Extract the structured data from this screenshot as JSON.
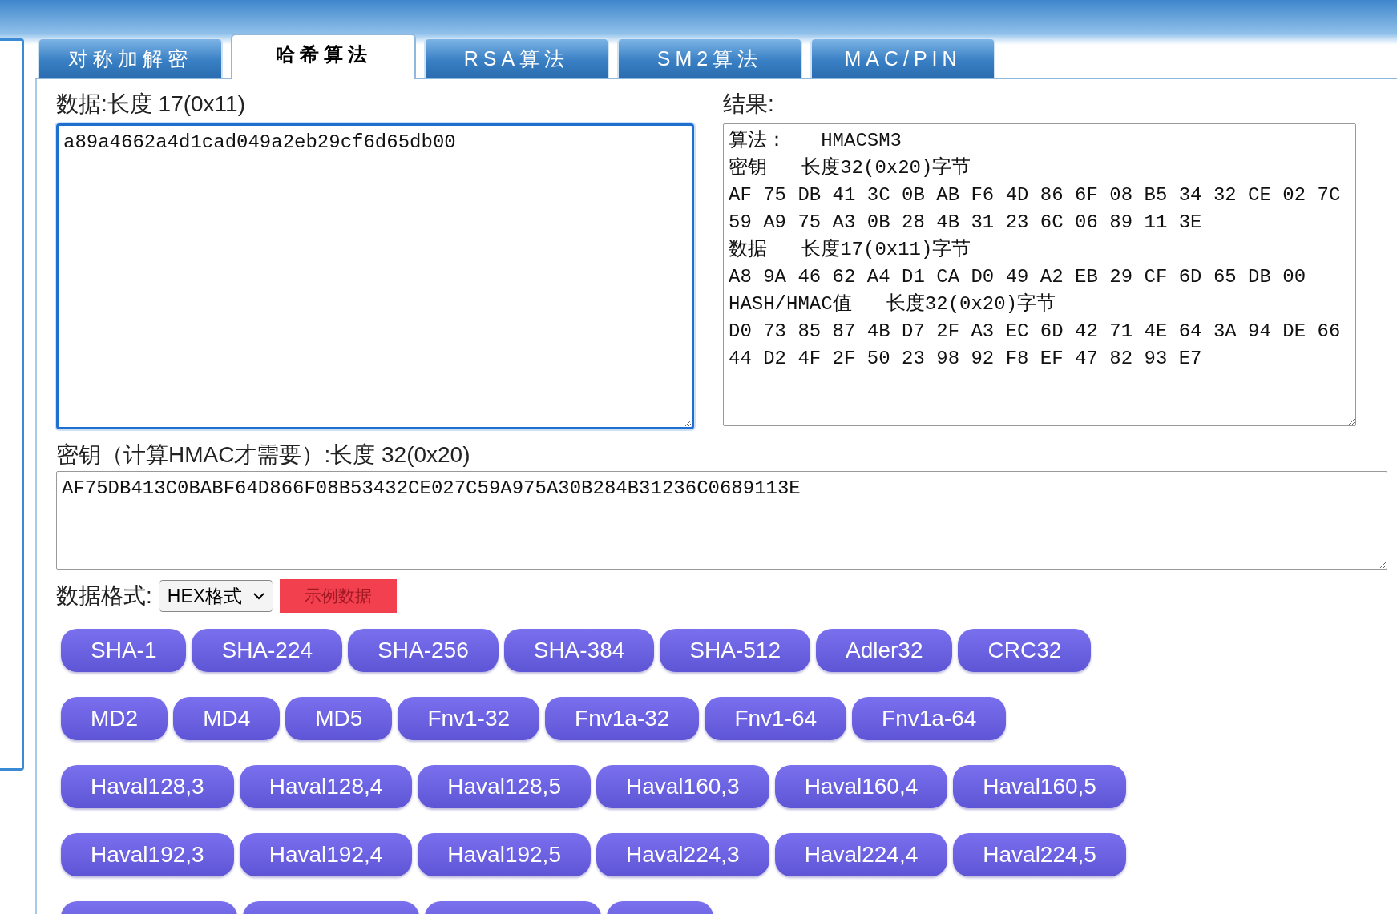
{
  "tabs": [
    {
      "label": "对称加解密",
      "selected": false
    },
    {
      "label": "哈希算法",
      "selected": true
    },
    {
      "label": "RSA算法",
      "selected": false
    },
    {
      "label": "SM2算法",
      "selected": false
    },
    {
      "label": "MAC/PIN",
      "selected": false
    }
  ],
  "data_field": {
    "label": "数据:长度 17(0x11)",
    "value": "a89a4662a4d1cad049a2eb29cf6d65db00",
    "focused": true
  },
  "result": {
    "label": "结果:",
    "lines": [
      "算法：   HMACSM3",
      "密钥   长度32(0x20)字节",
      "AF 75 DB 41 3C 0B AB F6 4D 86 6F 08 B5 34 32 CE 02 7C",
      "59 A9 75 A3 0B 28 4B 31 23 6C 06 89 11 3E",
      "数据   长度17(0x11)字节",
      "A8 9A 46 62 A4 D1 CA D0 49 A2 EB 29 CF 6D 65 DB 00",
      "HASH/HMAC值   长度32(0x20)字节",
      "D0 73 85 87 4B D7 2F A3 EC 6D 42 71 4E 64 3A 94 DE 66",
      "44 D2 4F 2F 50 23 98 92 F8 EF 47 82 93 E7"
    ]
  },
  "key_field": {
    "label": "密钥（计算HMAC才需要）:长度 32(0x20)",
    "value": "AF75DB413C0BABF64D866F08B53432CE027C59A975A30B284B31236C0689113E"
  },
  "format": {
    "label": "数据格式:",
    "value": "HEX格式"
  },
  "sample_button": "示例数据",
  "hash_buttons": [
    [
      {
        "label": "SHA-1"
      },
      {
        "label": "SHA-224"
      },
      {
        "label": "SHA-256"
      },
      {
        "label": "SHA-384"
      },
      {
        "label": "SHA-512"
      },
      {
        "label": "Adler32"
      },
      {
        "label": "CRC32"
      }
    ],
    [
      {
        "label": "MD2"
      },
      {
        "label": "MD4"
      },
      {
        "label": "MD5"
      },
      {
        "label": "Fnv1-32"
      },
      {
        "label": "Fnv1a-32"
      },
      {
        "label": "Fnv1-64"
      },
      {
        "label": "Fnv1a-64"
      }
    ],
    [
      {
        "label": "Haval128,3"
      },
      {
        "label": "Haval128,4"
      },
      {
        "label": "Haval128,5"
      },
      {
        "label": "Haval160,3"
      },
      {
        "label": "Haval160,4"
      },
      {
        "label": "Haval160,5"
      }
    ],
    [
      {
        "label": "Haval192,3"
      },
      {
        "label": "Haval192,4"
      },
      {
        "label": "Haval192,5"
      },
      {
        "label": "Haval224,3"
      },
      {
        "label": "Haval224,4"
      },
      {
        "label": "Haval224,5"
      }
    ]
  ]
}
